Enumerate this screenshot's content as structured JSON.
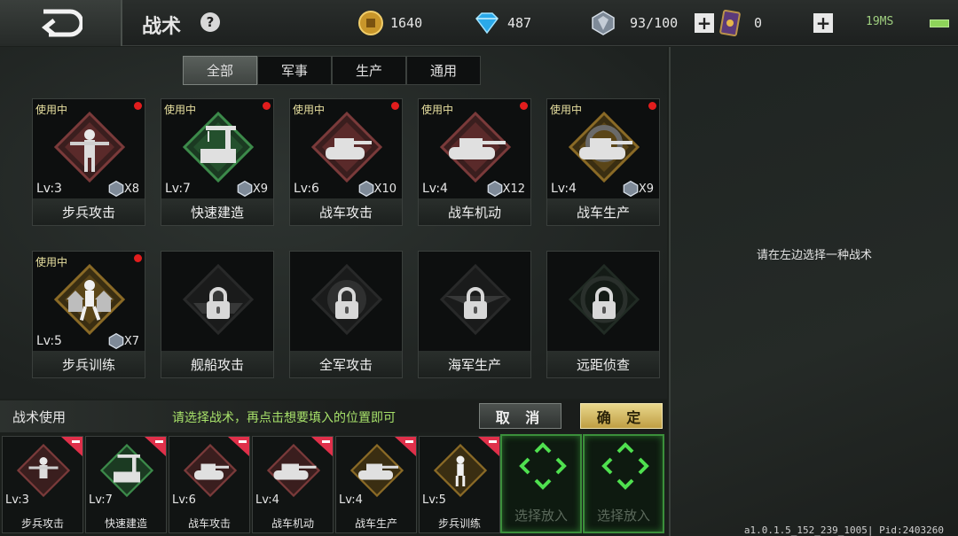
{
  "header": {
    "title": "战术",
    "help": "?",
    "resources": {
      "gold": "1640",
      "diamond": "487",
      "crystal": "93/100",
      "card": "0"
    },
    "ping": "19MS",
    "battery_level": 1.0
  },
  "tabs": [
    {
      "label": "全部",
      "active": true
    },
    {
      "label": "军事",
      "active": false
    },
    {
      "label": "生产",
      "active": false
    },
    {
      "label": "通用",
      "active": false
    }
  ],
  "tactics": [
    {
      "name": "步兵攻击",
      "in_use": "使用中",
      "level": "Lv:3",
      "count": "X8",
      "icon": "infantry-attack-icon",
      "locked": false
    },
    {
      "name": "快速建造",
      "in_use": "使用中",
      "level": "Lv:7",
      "count": "X9",
      "icon": "rapid-build-icon",
      "locked": false
    },
    {
      "name": "战车攻击",
      "in_use": "使用中",
      "level": "Lv:6",
      "count": "X10",
      "icon": "tank-attack-icon",
      "locked": false
    },
    {
      "name": "战车机动",
      "in_use": "使用中",
      "level": "Lv:4",
      "count": "X12",
      "icon": "tank-maneuver-icon",
      "locked": false
    },
    {
      "name": "战车生产",
      "in_use": "使用中",
      "level": "Lv:4",
      "count": "X9",
      "icon": "tank-production-icon",
      "locked": false
    },
    {
      "name": "步兵训练",
      "in_use": "使用中",
      "level": "Lv:5",
      "count": "X7",
      "icon": "infantry-training-icon",
      "locked": false
    },
    {
      "name": "舰船攻击",
      "icon": "ship-attack-icon",
      "locked": true
    },
    {
      "name": "全军攻击",
      "icon": "all-army-attack-icon",
      "locked": true
    },
    {
      "name": "海军生产",
      "icon": "navy-production-icon",
      "locked": true
    },
    {
      "name": "远距侦查",
      "icon": "long-range-recon-icon",
      "locked": true
    }
  ],
  "bottom": {
    "title": "战术使用",
    "hint": "请选择战术，再点击想要填入的位置即可",
    "cancel": "取 消",
    "confirm": "确 定",
    "slots": [
      {
        "name": "步兵攻击",
        "level": "Lv:3"
      },
      {
        "name": "快速建造",
        "level": "Lv:7"
      },
      {
        "name": "战车攻击",
        "level": "Lv:6"
      },
      {
        "name": "战车机动",
        "level": "Lv:4"
      },
      {
        "name": "战车生产",
        "level": "Lv:4"
      },
      {
        "name": "步兵训练",
        "level": "Lv:5"
      }
    ],
    "empty_slot_label": "选择放入"
  },
  "right_panel": {
    "hint": "请在左边选择一种战术"
  },
  "version": "a1.0.1.5_152_239_1005| Pid:2403260"
}
